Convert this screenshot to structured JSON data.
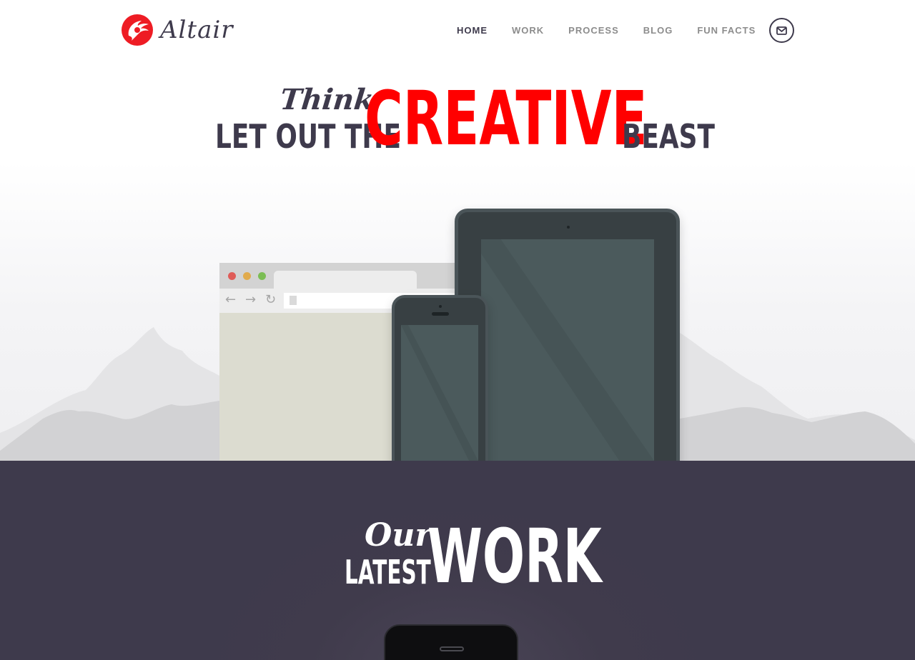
{
  "brand": {
    "name": "Altair",
    "accent_color": "#ee1c24",
    "text_color": "#3e3a4c"
  },
  "nav": {
    "items": [
      {
        "label": "HOME",
        "active": true
      },
      {
        "label": "WORK",
        "active": false
      },
      {
        "label": "PROCESS",
        "active": false
      },
      {
        "label": "BLOG",
        "active": false
      },
      {
        "label": "FUN FACTS",
        "active": false
      }
    ],
    "mail_icon": "envelope-icon"
  },
  "hero": {
    "script_word": "Think",
    "left_text": "LET OUT THE",
    "highlight": "CREATIVE",
    "right_text": "BEAST",
    "highlight_color": "#ff0000",
    "devices": [
      "browser-window",
      "tablet",
      "phone"
    ]
  },
  "work_section": {
    "script_word": "Our",
    "small_text": "LATEST",
    "big_text": "WORK",
    "background_color": "#3e3a4c"
  }
}
